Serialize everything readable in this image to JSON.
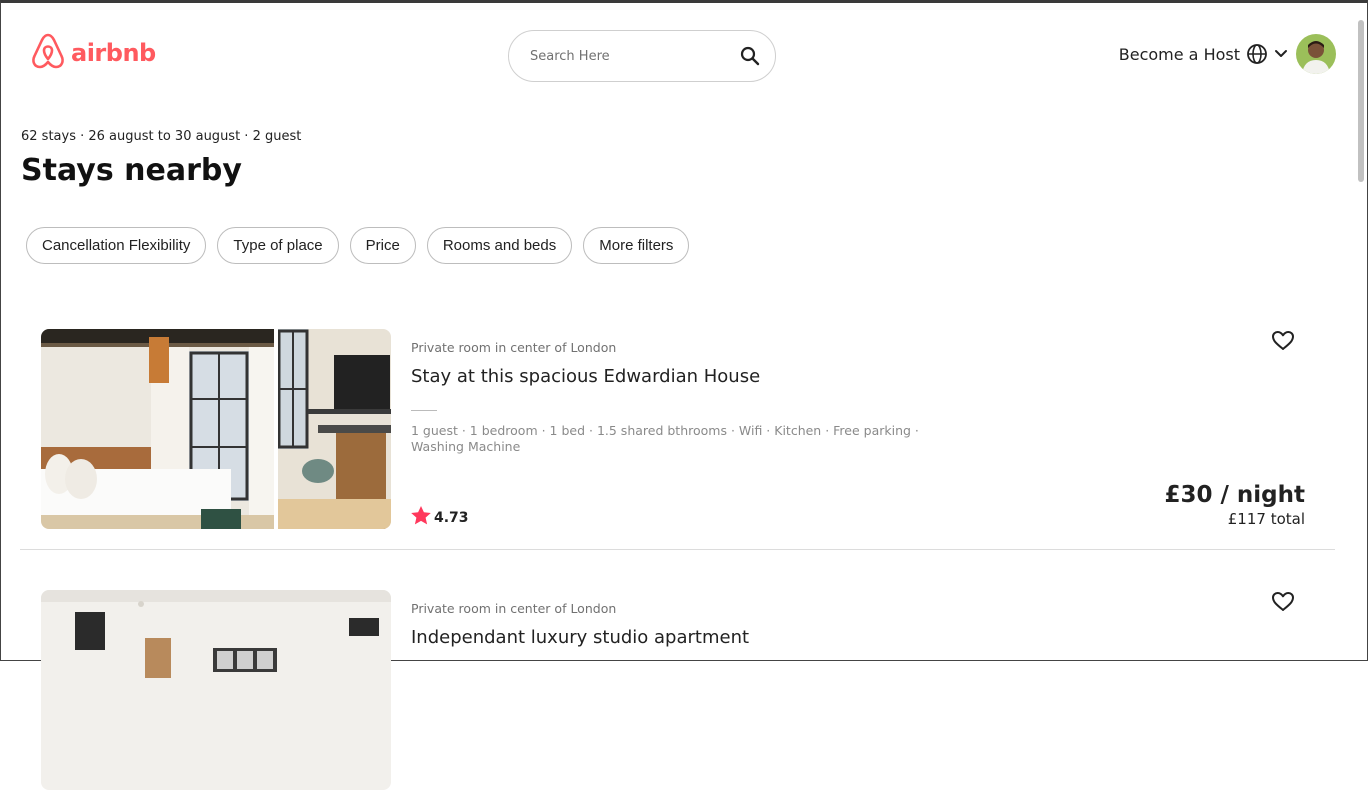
{
  "brand": {
    "name": "airbnb",
    "color": "#ff5a5f"
  },
  "search": {
    "placeholder": "Search Here",
    "value": ""
  },
  "header": {
    "host_label": "Become a Host"
  },
  "page": {
    "summary": "62 stays · 26 august to 30 august · 2 guest",
    "title": "Stays nearby"
  },
  "filters": [
    "Cancellation Flexibility",
    "Type of place",
    "Price",
    "Rooms and beds",
    "More filters"
  ],
  "listings": [
    {
      "type": "Private room in center of London",
      "name": "Stay at this spacious Edwardian House",
      "amenities": "1 guest · 1 bedroom · 1 bed · 1.5 shared bthrooms · Wifi · Kitchen · Free parking · Washing Machine",
      "rating": "4.73",
      "price": "£30 / night",
      "total": "£117 total"
    },
    {
      "type": "Private room in center of London",
      "name": "Independant luxury studio apartment"
    }
  ],
  "icons": {
    "logo": "airbnb-logo-icon",
    "search": "search-icon",
    "globe": "globe-icon",
    "chevron": "chevron-down-icon",
    "heart": "heart-icon",
    "star": "star-icon"
  },
  "colors": {
    "star": "#ff385c",
    "accent": "#ff5a5f"
  }
}
